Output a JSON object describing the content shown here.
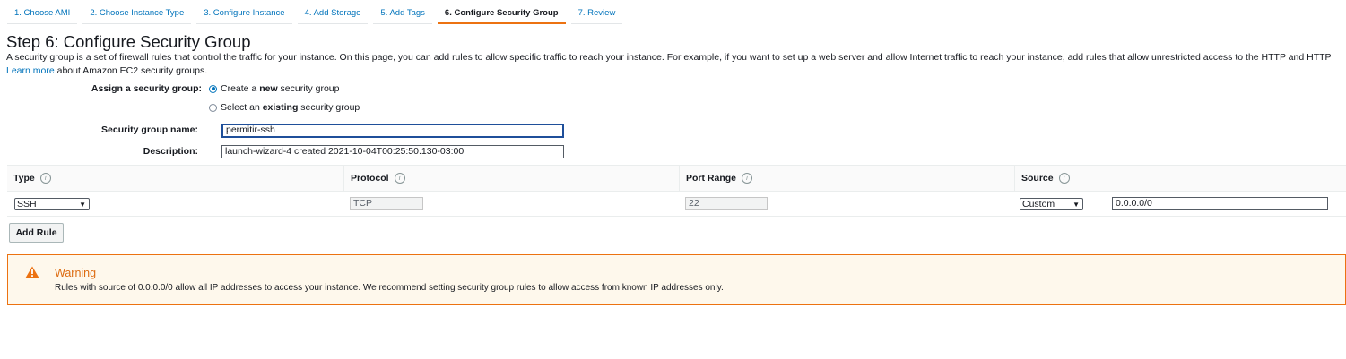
{
  "wizard": {
    "tabs": [
      {
        "label": "1. Choose AMI"
      },
      {
        "label": "2. Choose Instance Type"
      },
      {
        "label": "3. Configure Instance"
      },
      {
        "label": "4. Add Storage"
      },
      {
        "label": "5. Add Tags"
      },
      {
        "label": "6. Configure Security Group"
      },
      {
        "label": "7. Review"
      }
    ],
    "active_index": 5
  },
  "page": {
    "title": "Step 6: Configure Security Group",
    "intro": "A security group is a set of firewall rules that control the traffic for your instance. On this page, you can add rules to allow specific traffic to reach your instance. For example, if you want to set up a web server and allow Internet traffic to reach your instance, add rules that allow unrestricted access to the HTTP and HTTP",
    "learn_more": "Learn more",
    "intro_tail": " about Amazon EC2 security groups."
  },
  "form": {
    "assign_label": "Assign a security group:",
    "option_create": {
      "pre": "Create a ",
      "bold": "new",
      "post": " security group",
      "selected": true
    },
    "option_existing": {
      "pre": "Select an ",
      "bold": "existing",
      "post": " security group",
      "selected": false
    },
    "name_label": "Security group name:",
    "name_value": "permitir-ssh",
    "desc_label": "Description:",
    "desc_value": "launch-wizard-4 created 2021-10-04T00:25:50.130-03:00"
  },
  "rules_table": {
    "headers": [
      "Type",
      "Protocol",
      "Port Range",
      "Source"
    ],
    "info_glyph": "i",
    "rows": [
      {
        "type": "SSH",
        "protocol": "TCP",
        "port_range": "22",
        "source_mode": "Custom",
        "source_cidr": "0.0.0.0/0"
      }
    ],
    "add_rule_label": "Add Rule"
  },
  "warning": {
    "icon": "warning-triangle-icon",
    "title": "Warning",
    "body": "Rules with source of 0.0.0.0/0 allow all IP addresses to access your instance. We recommend setting security group rules to allow access from known IP addresses only.",
    "border_color": "#ec7211",
    "title_color": "#dd6b10",
    "background": "#fef8ec"
  },
  "colors": {
    "link": "#0073bb",
    "active_tab_underline": "#ec7211",
    "text": "#16191f"
  }
}
